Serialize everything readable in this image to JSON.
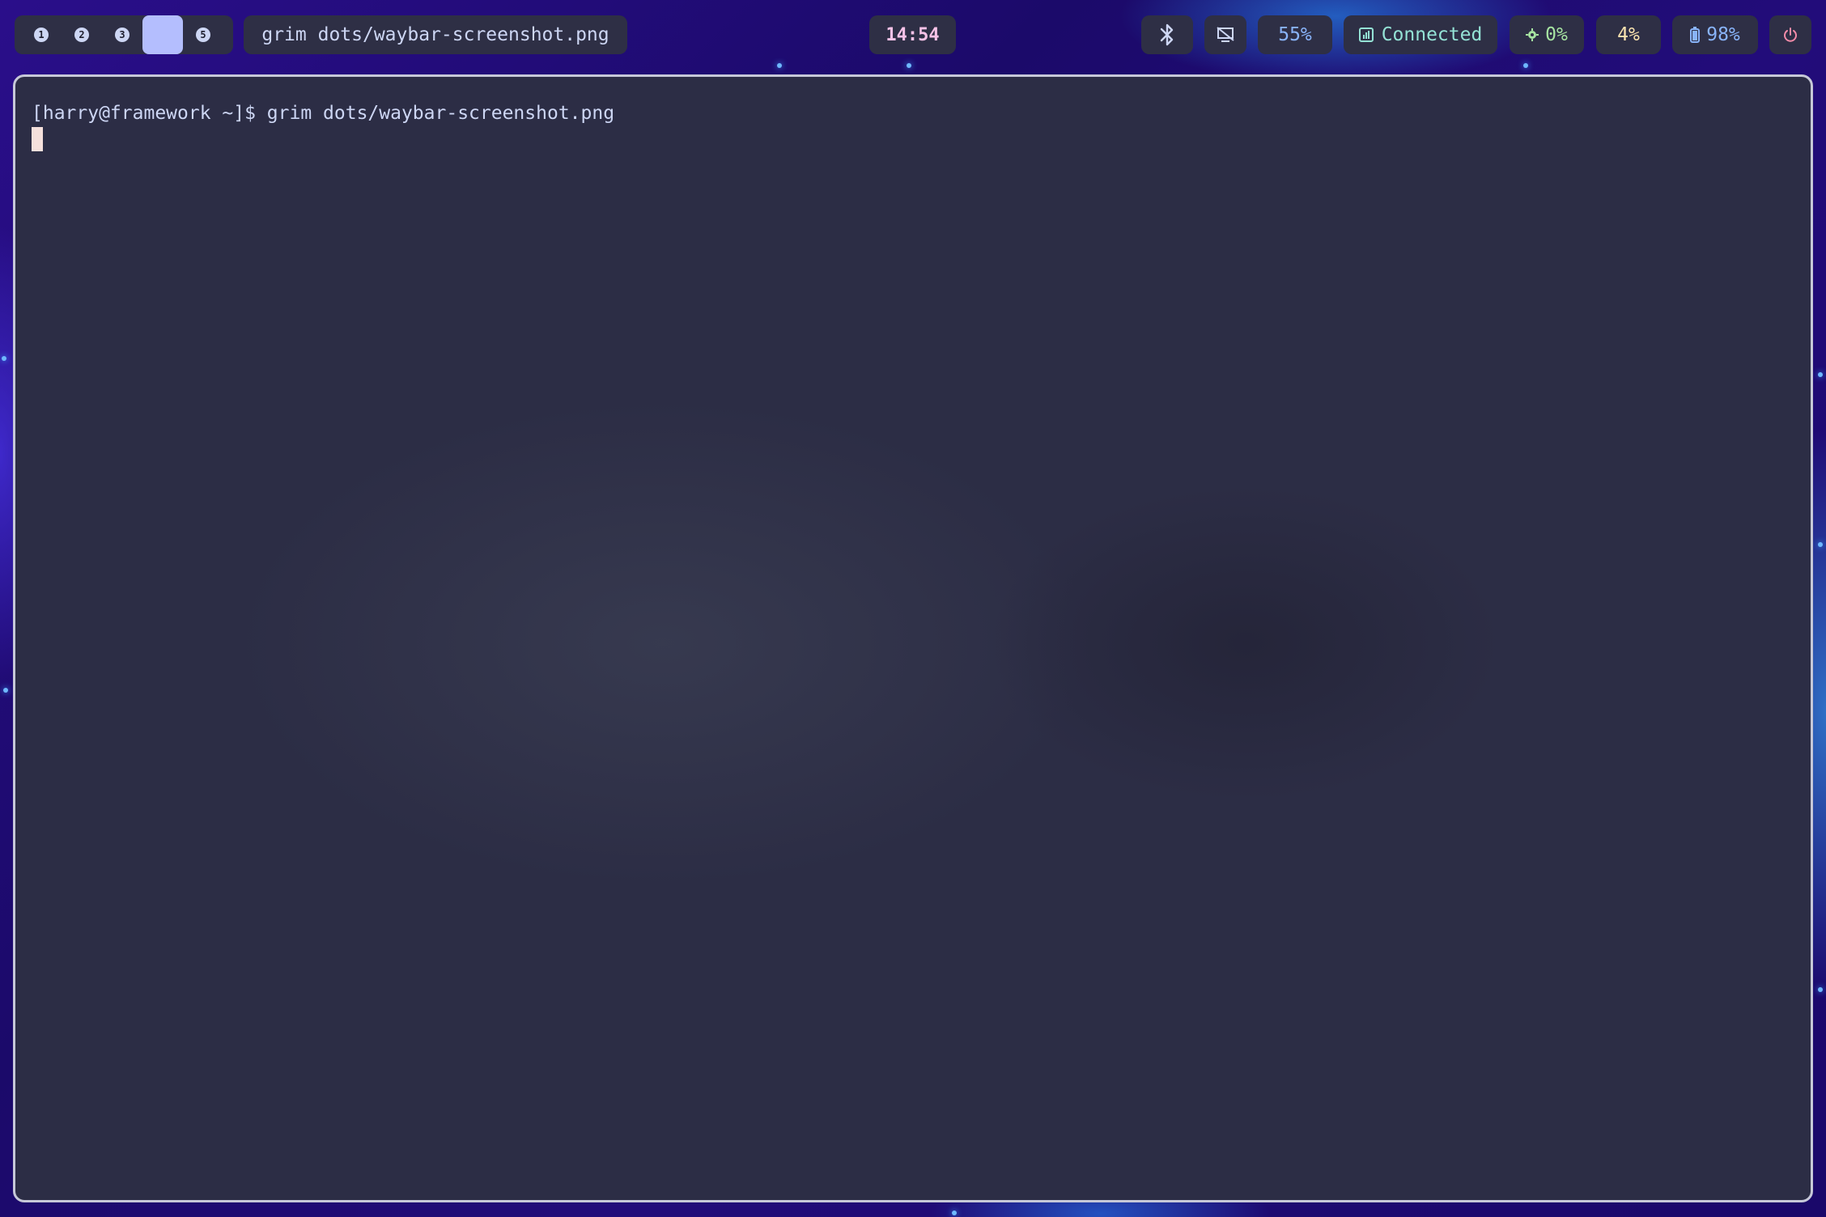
{
  "workspaces": [
    {
      "label": "1",
      "active": false
    },
    {
      "label": "2",
      "active": false
    },
    {
      "label": "3",
      "active": false
    },
    {
      "label": "",
      "active": true
    },
    {
      "label": "5",
      "active": false
    }
  ],
  "window_title": "grim dots/waybar-screenshot.png",
  "clock": "14:54",
  "modules": {
    "bluetooth_icon": "bluetooth-icon",
    "brightness_icon": "display-off-icon",
    "volume": "55%",
    "network_label": "Connected",
    "network_icon": "network-icon",
    "cpu": "0%",
    "cpu_icon": "cpu-icon",
    "memory": "4%",
    "battery": "98%",
    "battery_icon": "battery-icon",
    "power_icon": "power-icon"
  },
  "terminal": {
    "prompt": "[harry@framework ~]$ grim dots/waybar-screenshot.png"
  },
  "colors": {
    "bar_bg": "#2e2f45",
    "active_workspace": "#b4befe",
    "clock": "#f5c2e7",
    "volume": "#89b4fa",
    "network": "#94e2d5",
    "cpu": "#a6e3a1",
    "memory": "#f9e2af",
    "battery": "#89b4fa",
    "power": "#f38ba8",
    "terminal_bg": "#2c2d45",
    "cursor": "#f5e0dc"
  }
}
